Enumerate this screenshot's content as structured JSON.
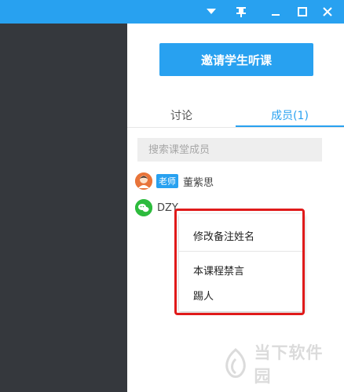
{
  "window": {
    "controls": [
      "dropdown-icon",
      "pin-icon",
      "minimize-icon",
      "maximize-icon",
      "close-icon"
    ]
  },
  "invite_button": {
    "label": "邀请学生听课"
  },
  "tabs": [
    {
      "label": "讨论",
      "active": false
    },
    {
      "label": "成员(1)",
      "active": true
    }
  ],
  "search": {
    "placeholder": "搜索课堂成员",
    "value": ""
  },
  "members": [
    {
      "badge": "老师",
      "name": "董紫思",
      "avatar": "teacher-avatar"
    },
    {
      "badge": "",
      "name": "DZY",
      "avatar": "wechat-icon"
    }
  ],
  "context_menu": {
    "items": [
      {
        "label": "修改备注姓名"
      },
      {
        "label": "本课程禁言"
      },
      {
        "label": "踢人"
      }
    ]
  },
  "watermark": {
    "text": "当下软件园"
  },
  "colors": {
    "accent": "#28a1f0",
    "sidebar_bg": "#35383d",
    "highlight_border": "#e01a1a"
  }
}
